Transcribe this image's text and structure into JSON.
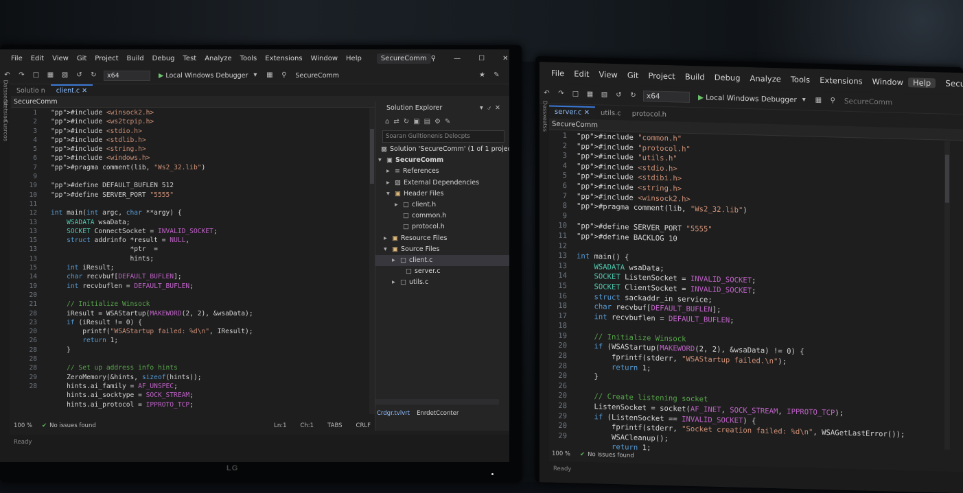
{
  "left": {
    "menu": [
      "File",
      "Edit",
      "View",
      "Git",
      "Project",
      "Build",
      "Debug",
      "Test",
      "Analyze",
      "Tools",
      "Extensions",
      "Window",
      "Help"
    ],
    "project": "SecureComm",
    "toolbar": {
      "platform": "x64",
      "debugger": "Local Windows Debugger",
      "solution_label": "SecureComm"
    },
    "tabs": {
      "inactive": "Solutio n",
      "active": "client.c"
    },
    "navbar": "SecureComm",
    "side_labels": [
      "Datsserst",
      "Sretsiad",
      "Cusrcos"
    ],
    "line_numbers": [
      "1",
      "2",
      "3",
      "4",
      "5",
      "6",
      "7",
      "9",
      "19",
      "10",
      "11",
      "12",
      "13",
      "13",
      "15",
      "13",
      "13",
      "15",
      "14",
      "19",
      "20",
      "21",
      "28",
      "23",
      "20",
      "26",
      "28",
      "28",
      "28",
      "29",
      "28"
    ],
    "code": [
      "#include <winsock2.h>",
      "#include <ws2tcpip.h>",
      "#include <stdio.h>",
      "#include <stdlib.h>",
      "#include <string.h>",
      "#include <windows.h>",
      "#pragma comment(lib, \"Ws2_32.lib\")",
      "",
      "#define DEFAULT_BUFLEN 512",
      "#define SERVER_PORT \"5555\"",
      "",
      "int main(int argc, char **argy) {",
      "    WSADATA wsaData;",
      "    SOCKET ConnectSocket = INVALID_SOCKET;",
      "    struct addrinfo *result = NULL,",
      "                    *ptr  =",
      "                    hints;",
      "    int iResult;",
      "    char recvbuf[DEFAULT_BUFLEN];",
      "    int recvbuflen = DEFAULT_BUFLEN;",
      "",
      "    // Initialize Winsock",
      "    iResult = WSAStartup(MAKEWORD(2, 2), &wsaData);",
      "    if (iResult != 0) {",
      "        printf(\"WSAStartup failed: %d\\n\", IResult);",
      "        return 1;",
      "    }",
      "",
      "    // Set up address info hints",
      "    ZeroMemory(&hints, sizeof(hints));",
      "    hints.ai_family = AF_UNSPEC;",
      "    hints.ai_socktype = SOCK_STREAM;",
      "    hints.ai_protocol = IPPROTO_TCP;"
    ],
    "status": {
      "zoom": "100 %",
      "issues": "No issues found",
      "ln": "Ln:1",
      "ch": "Ch:1",
      "tabs": "TABS",
      "eol": "CRLF",
      "ready": "Ready"
    },
    "solution_explorer": {
      "title": "Solution Explorer",
      "search": "Soaran Gulltionenis Delocpts",
      "solution": "Solution 'SecureComm' (1 of 1 project)",
      "project": "SecureComm",
      "nodes": [
        "References",
        "External Dependencies",
        "Header Files",
        "client.h",
        "common.h",
        "protocol.h",
        "Resource Files",
        "Source Files",
        "client.c",
        "server.c",
        "utils.c"
      ],
      "bottom_tabs": [
        "Crdgr.tvlvrt",
        "EnrdetCconter"
      ]
    }
  },
  "right": {
    "menu": [
      "File",
      "Edit",
      "View",
      "Git",
      "Project",
      "Build",
      "Debug",
      "Analyze",
      "Tools",
      "Extensions",
      "Window",
      "Help"
    ],
    "project": "SecureComm",
    "toolbar": {
      "platform": "x64",
      "debugger": "Local Windows Debugger",
      "solution_label": "SecureComm"
    },
    "tabs": [
      "server.c",
      "utils.c",
      "protocol.h"
    ],
    "navbar": "SecureComm",
    "side_label": "Dassxeatss",
    "line_numbers": [
      "1",
      "2",
      "3",
      "4",
      "5",
      "6",
      "7",
      "8",
      "9",
      "10",
      "11",
      "12",
      "13",
      "13",
      "14",
      "15",
      "16",
      "18",
      "17",
      "18",
      "19",
      "20",
      "28",
      "28",
      "20",
      "26",
      "20",
      "28",
      "29",
      "20",
      "29"
    ],
    "code": [
      "#include \"common.h\"",
      "#include \"protocol.h\"",
      "#include \"utils.h\"",
      "#include <stdio.h>",
      "#include <stdibi.h>",
      "#include <string.h>",
      "#include <winsock2.h>",
      "#pragma comment(lib, \"Ws2_32.lib\")",
      "",
      "#define SERVER_PORT \"5555\"",
      "#define BACKLOG 10",
      "",
      "int main() {",
      "    WSADATA wsaData;",
      "    SOCKET ListenSocket = INVALID_SOCKET;",
      "    SOCKET ClientSocket = INVALID_SOCKET;",
      "    struct sackaddr_in service;",
      "    char recvbuf[DEFAULT_BUFLEN];",
      "    int recvbuflen = DEFAULT_BUFLEN;",
      "",
      "    // Initialize Winsock",
      "    if (WSAStartup(MAKEWORD(2, 2), &wsaData) != 0) {",
      "        fprintf(stderr, \"WSAStartup failed.\\n\");",
      "        return 1;",
      "    }",
      "",
      "    // Create listening socket",
      "    ListenSocket = socket(AF_INET, SOCK_STREAM, IPPROTO_TCP);",
      "    if (ListenSocket == INVALID_SOCKET) {",
      "        fprintf(stderr, \"Socket creation failed: %d\\n\", WSAGetLastError());",
      "        WSACleanup();",
      "        return 1;"
    ],
    "status": {
      "zoom": "100 %",
      "issues": "No issues found",
      "ready": "Ready"
    }
  },
  "brand": "LG"
}
